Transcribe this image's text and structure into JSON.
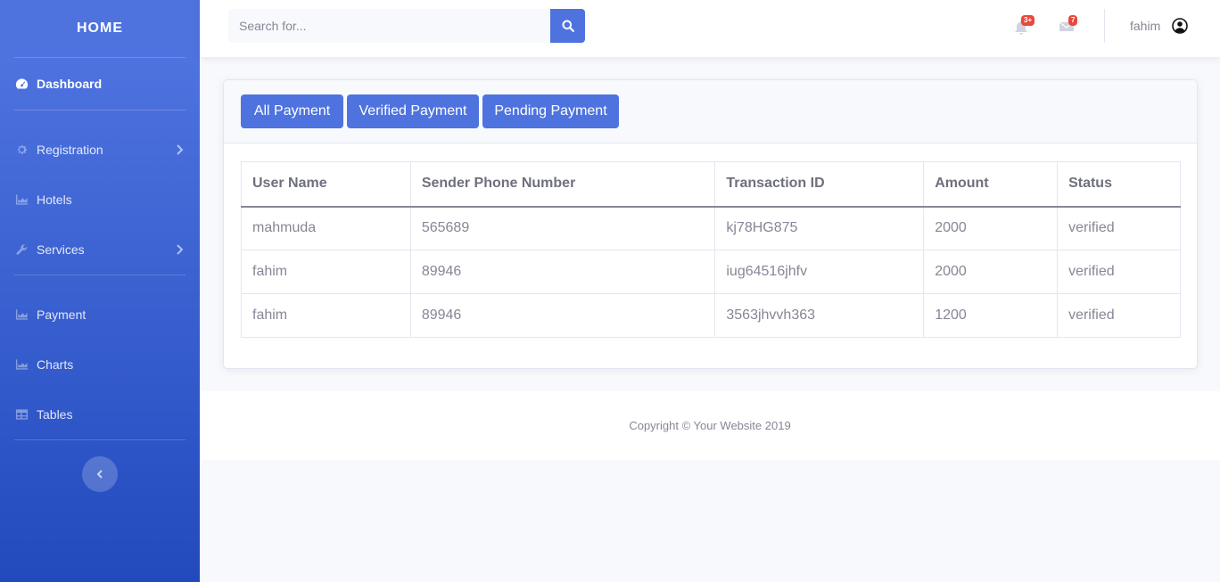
{
  "sidebar": {
    "brand": "HOME",
    "items": [
      {
        "label": "Dashboard",
        "icon": "dashboard-icon"
      },
      {
        "label": "Registration",
        "icon": "gear-icon"
      },
      {
        "label": "Hotels",
        "icon": "area-chart-icon"
      },
      {
        "label": "Services",
        "icon": "wrench-icon"
      },
      {
        "label": "Payment",
        "icon": "area-chart-icon"
      },
      {
        "label": "Charts",
        "icon": "area-chart-icon"
      },
      {
        "label": "Tables",
        "icon": "table-icon"
      }
    ],
    "toggle_icon": "chevron-left-icon"
  },
  "topbar": {
    "search_placeholder": "Search for...",
    "alerts_badge": "3+",
    "messages_badge": "7",
    "user_name": "fahim"
  },
  "payments": {
    "tabs": [
      "All Payment",
      "Verified Payment",
      "Pending Payment"
    ],
    "columns": [
      "User Name",
      "Sender Phone Number",
      "Transaction ID",
      "Amount",
      "Status"
    ],
    "rows": [
      [
        "mahmuda",
        "565689",
        "kj78HG875",
        "2000",
        "verified"
      ],
      [
        "fahim",
        "89946",
        "iug64516jhfv",
        "2000",
        "verified"
      ],
      [
        "fahim",
        "89946",
        "3563jhvvh363",
        "1200",
        "verified"
      ]
    ]
  },
  "footer": {
    "copyright": "Copyright © Your Website 2019"
  },
  "colors": {
    "primary": "#4e73df",
    "danger": "#e74a3b",
    "text_muted": "#858796"
  }
}
